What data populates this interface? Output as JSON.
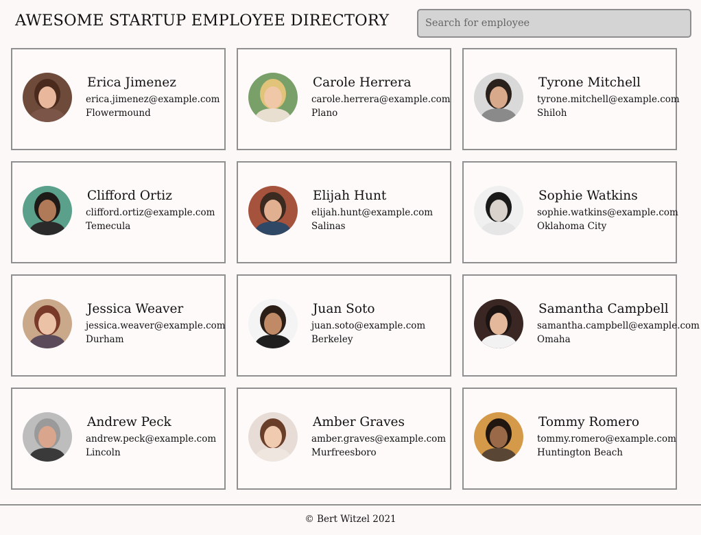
{
  "header": {
    "title": "AWESOME STARTUP EMPLOYEE DIRECTORY",
    "search_placeholder": "Search for employee"
  },
  "employees": [
    {
      "name": "Erica Jimenez",
      "email": "erica.jimenez@example.com",
      "city": "Flowermound",
      "avatar": {
        "bg": "#6d4a3a",
        "hair": "#4a2a1c",
        "skin": "#e8b79c",
        "shirt": "#7a5548"
      }
    },
    {
      "name": "Carole Herrera",
      "email": "carole.herrera@example.com",
      "city": "Plano",
      "avatar": {
        "bg": "#7aa06a",
        "hair": "#e2c37a",
        "skin": "#f0c8a8",
        "shirt": "#e9dfd0"
      }
    },
    {
      "name": "Tyrone Mitchell",
      "email": "tyrone.mitchell@example.com",
      "city": "Shiloh",
      "avatar": {
        "bg": "#d9d9d9",
        "hair": "#2b211c",
        "skin": "#d8a98a",
        "shirt": "#8a8a8a"
      }
    },
    {
      "name": "Clifford Ortiz",
      "email": "clifford.ortiz@example.com",
      "city": "Temecula",
      "avatar": {
        "bg": "#5aa08a",
        "hair": "#1e1a18",
        "skin": "#b07a58",
        "shirt": "#2a2a2a"
      }
    },
    {
      "name": "Elijah Hunt",
      "email": "elijah.hunt@example.com",
      "city": "Salinas",
      "avatar": {
        "bg": "#a6533e",
        "hair": "#3a2a20",
        "skin": "#e0b090",
        "shirt": "#2f4866"
      }
    },
    {
      "name": "Sophie Watkins",
      "email": "sophie.watkins@example.com",
      "city": "Oklahoma City",
      "avatar": {
        "bg": "#f0f0f0",
        "hair": "#1a1a1a",
        "skin": "#d9d2cc",
        "shirt": "#e6e6e6"
      }
    },
    {
      "name": "Jessica Weaver",
      "email": "jessica.weaver@example.com",
      "city": "Durham",
      "avatar": {
        "bg": "#c9a98a",
        "hair": "#7a3a2a",
        "skin": "#ecc2a6",
        "shirt": "#5a4a5a"
      }
    },
    {
      "name": "Juan Soto",
      "email": "juan.soto@example.com",
      "city": "Berkeley",
      "avatar": {
        "bg": "#f4f4f4",
        "hair": "#2a1e16",
        "skin": "#c08a66",
        "shirt": "#1f1f1f"
      }
    },
    {
      "name": "Samantha Campbell",
      "email": "samantha.campbell@example.com",
      "city": "Omaha",
      "avatar": {
        "bg": "#3a2622",
        "hair": "#1c1412",
        "skin": "#e4b89a",
        "shirt": "#f2f2f2"
      }
    },
    {
      "name": "Andrew Peck",
      "email": "andrew.peck@example.com",
      "city": "Lincoln",
      "avatar": {
        "bg": "#bdbdbd",
        "hair": "#9a9a9a",
        "skin": "#d9a58c",
        "shirt": "#3a3a3a"
      }
    },
    {
      "name": "Amber Graves",
      "email": "amber.graves@example.com",
      "city": "Murfreesboro",
      "avatar": {
        "bg": "#e8dcd6",
        "hair": "#6a3f2a",
        "skin": "#f0cbb0",
        "shirt": "#efe6e0"
      }
    },
    {
      "name": "Tommy Romero",
      "email": "tommy.romero@example.com",
      "city": "Huntington Beach",
      "avatar": {
        "bg": "#d49a4a",
        "hair": "#221610",
        "skin": "#9a6a48",
        "shirt": "#5a4634"
      }
    }
  ],
  "footer": {
    "text": "© Bert Witzel 2021"
  }
}
